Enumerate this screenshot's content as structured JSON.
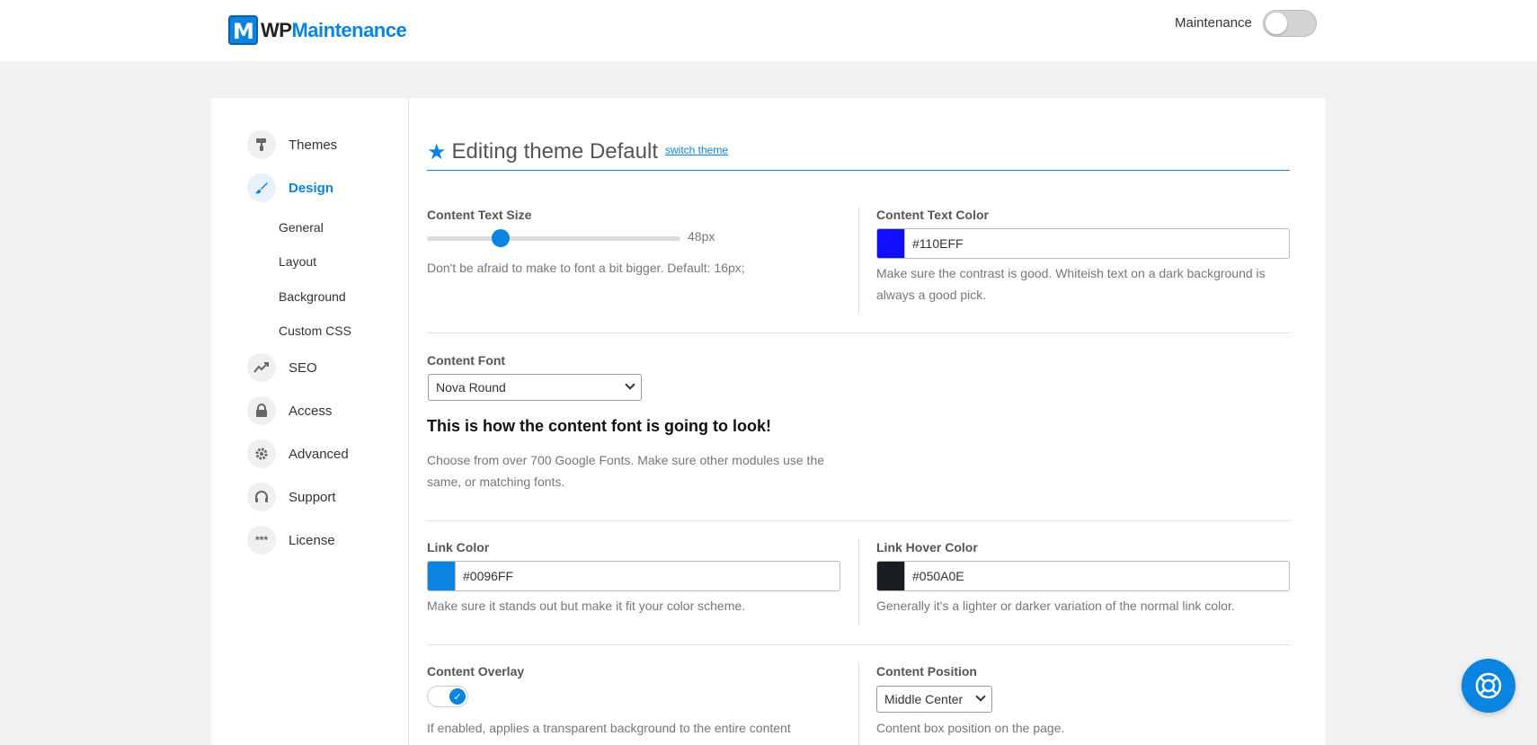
{
  "header": {
    "logo_icon_letter": "M",
    "logo_wp": "WP",
    "logo_maintenance": "Maintenance",
    "maintenance_label": "Maintenance",
    "maintenance_enabled": false
  },
  "sidebar": {
    "items": [
      {
        "label": "Themes",
        "icon": "paint-roller-icon"
      },
      {
        "label": "Design",
        "icon": "brush-icon",
        "active": true
      },
      {
        "label": "SEO",
        "icon": "chart-trend-icon"
      },
      {
        "label": "Access",
        "icon": "lock-icon"
      },
      {
        "label": "Advanced",
        "icon": "gear-icon"
      },
      {
        "label": "Support",
        "icon": "headset-icon"
      },
      {
        "label": "License",
        "icon": "password-icon"
      }
    ],
    "design_subitems": [
      "General",
      "Layout",
      "Background",
      "Custom CSS"
    ]
  },
  "main": {
    "heading": "Editing theme Default",
    "switch_link": "switch theme",
    "text_size": {
      "label": "Content Text Size",
      "value": "48px",
      "slider_fraction": 0.17,
      "help": "Don't be afraid to make to font a bit bigger. Default: 16px;"
    },
    "text_color": {
      "label": "Content Text Color",
      "value": "#110EFF",
      "swatch": "#110EFF",
      "help": "Make sure the contrast is good. Whiteish text on a dark background is always a good pick."
    },
    "font": {
      "label": "Content Font",
      "selected": "Nova Round",
      "preview": "This is how the content font is going to look!",
      "help": "Choose from over 700 Google Fonts. Make sure other modules use the same, or matching fonts."
    },
    "link_color": {
      "label": "Link Color",
      "value": "#0096FF",
      "swatch": "#0a84e0",
      "help": "Make sure it stands out but make it fit your color scheme."
    },
    "link_hover_color": {
      "label": "Link Hover Color",
      "value": "#050A0E",
      "swatch": "#1a1d20",
      "help": "Generally it's a lighter or darker variation of the normal link color."
    },
    "overlay": {
      "label": "Content Overlay",
      "enabled": true,
      "help": "If enabled, applies a transparent background to the entire content"
    },
    "position": {
      "label": "Content Position",
      "selected": "Middle Center",
      "help": "Content box position on the page."
    }
  },
  "colors": {
    "accent": "#0a84e0"
  }
}
